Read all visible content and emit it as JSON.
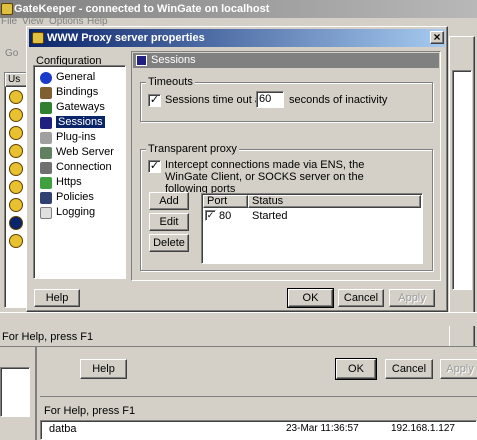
{
  "bg_window": {
    "title": "GateKeeper - connected to WinGate on localhost",
    "menu": [
      "File",
      "View",
      "Options",
      "Help"
    ],
    "toolbar_fragment": "Go",
    "left_header_fragment": "Us",
    "status_text": "For Help, press F1",
    "bottom_buttons": {
      "help": "Help",
      "ok": "OK",
      "cancel": "Cancel",
      "apply": "Apply"
    },
    "bottom_status": "For Help, press F1",
    "bottom_list_fragments": [
      "datba",
      "23-Mar 11:36:57",
      "192.168.1.127"
    ]
  },
  "dialog": {
    "title": "WWW Proxy server properties",
    "close_label": "×",
    "configuration_label": "Configuration",
    "nav_items": [
      {
        "label": "General",
        "icon": "info-icon",
        "color": "#1a3cc8"
      },
      {
        "label": "Bindings",
        "icon": "bindings-icon",
        "color": "#806030"
      },
      {
        "label": "Gateways",
        "icon": "gateways-icon",
        "color": "#308030"
      },
      {
        "label": "Sessions",
        "icon": "sessions-icon",
        "color": "#202080",
        "selected": true
      },
      {
        "label": "Plug-ins",
        "icon": "plugins-icon",
        "color": "#a0a0a0"
      },
      {
        "label": "Web Server",
        "icon": "web-server-icon",
        "color": "#608060"
      },
      {
        "label": "Connection",
        "icon": "connection-icon",
        "color": "#707070"
      },
      {
        "label": "Https",
        "icon": "https-icon",
        "color": "#40a040"
      },
      {
        "label": "Policies",
        "icon": "policies-icon",
        "color": "#304070"
      },
      {
        "label": "Logging",
        "icon": "logging-icon",
        "color": "#e0e0e0"
      }
    ],
    "panel_header": "Sessions",
    "timeouts": {
      "group_label": "Timeouts",
      "checkbox_checked": true,
      "label_before": "Sessions time out after",
      "value": "60",
      "label_after": "seconds of inactivity"
    },
    "transparent": {
      "group_label": "Transparent proxy",
      "checkbox_checked": true,
      "text": "Intercept connections made via ENS, the WinGate Client, or SOCKS server on the following ports",
      "buttons": {
        "add": "Add",
        "edit": "Edit",
        "delete": "Delete"
      },
      "columns": [
        "Port",
        "Status"
      ],
      "rows": [
        {
          "checked": true,
          "port": "80",
          "status": "Started"
        }
      ]
    },
    "footer": {
      "help": "Help",
      "ok": "OK",
      "cancel": "Cancel",
      "apply": "Apply"
    }
  },
  "colors": {
    "title_active": "#0a246a",
    "title_active_end": "#a6caf0",
    "title_inactive": "#808080",
    "selection": "#0a246a"
  }
}
